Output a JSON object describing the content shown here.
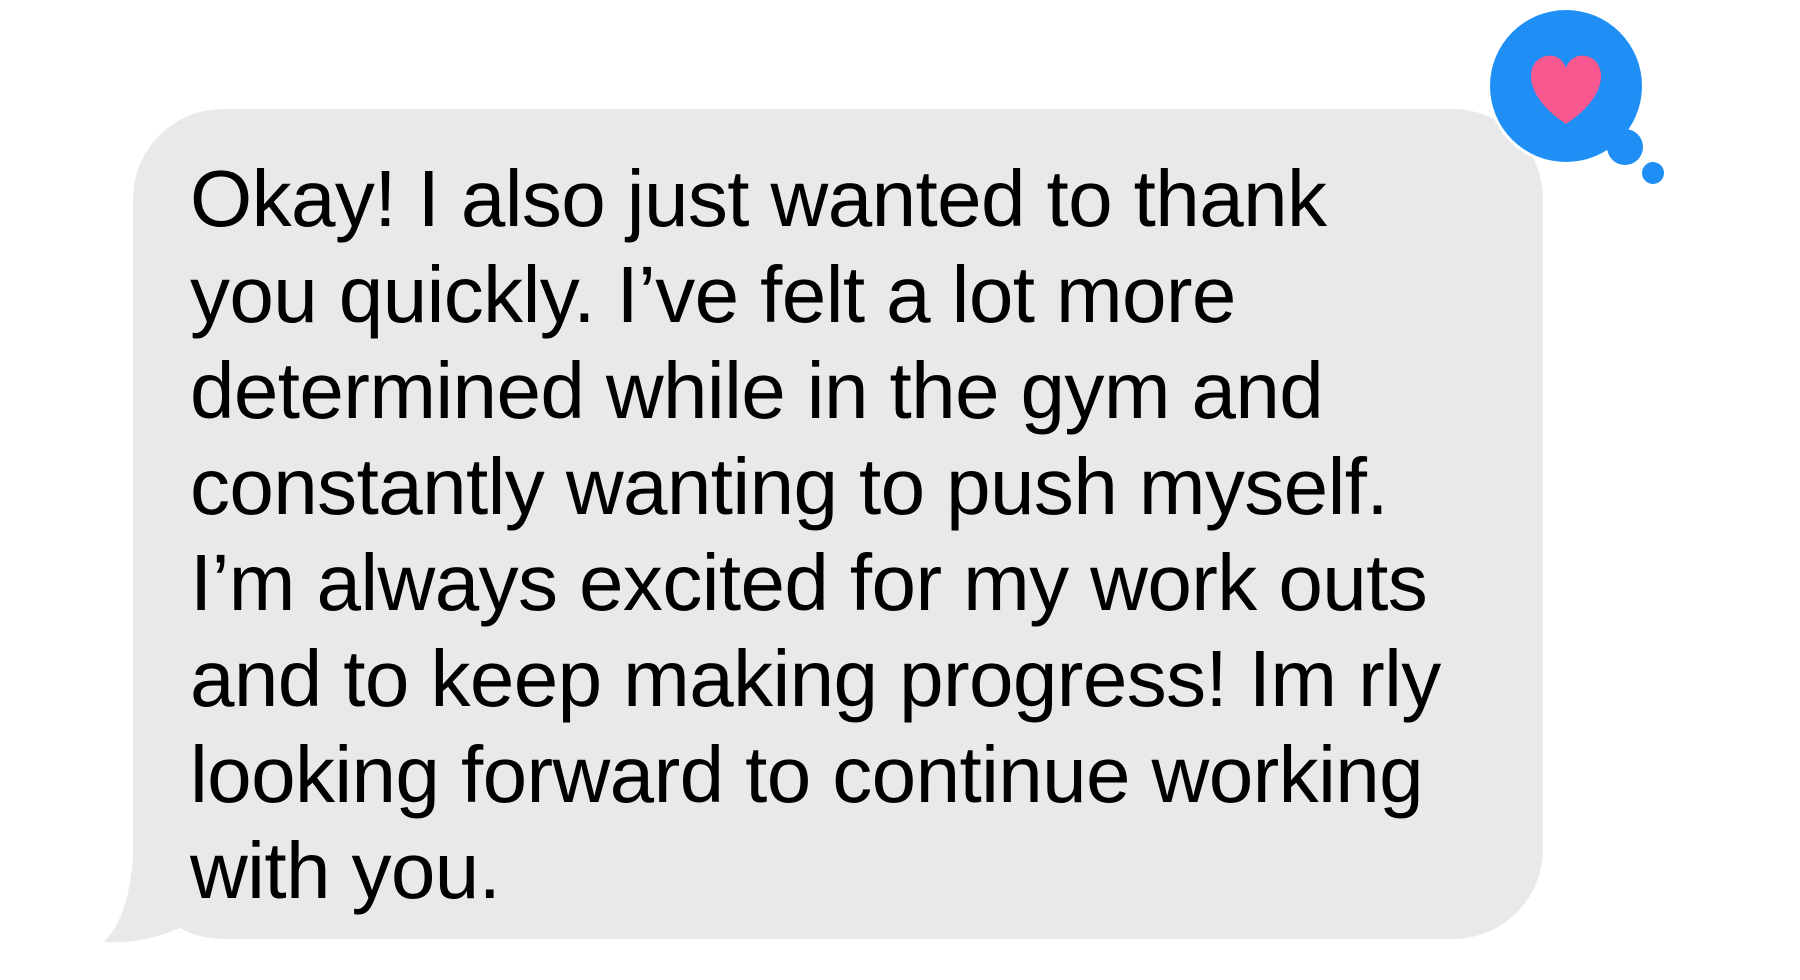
{
  "message": {
    "text": "Okay! I also just wanted to thank\nyou quickly. I’ve felt a lot more\ndetermined while in the gym and\nconstantly wanting to push myself.\nI’m always excited for my work outs\nand to keep making progress! Im rly\nlooking forward to continue working\nwith you.",
    "sender": "incoming"
  },
  "reaction": {
    "icon": "heart-icon",
    "heart_color": "#f6588f",
    "bubble_color": "#1f8ff5"
  },
  "colors": {
    "bubble_background": "#e9e9eb",
    "text": "#000000",
    "page_background": "#ffffff"
  }
}
